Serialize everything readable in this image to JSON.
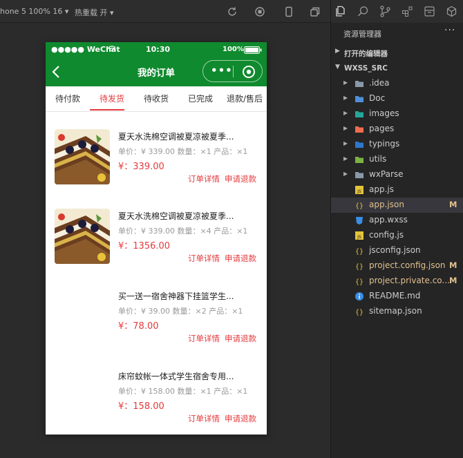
{
  "toolbar": {
    "device_label": "hone 5 100% 16",
    "hotreload_label": "热重载 开"
  },
  "explorer": {
    "title": "资源管理器",
    "more": "···",
    "open_editors": "打开的编辑器",
    "project": "WXSS_SRC",
    "folders": [
      {
        "name": ".idea",
        "icon": "folder-icon",
        "color": "#8a99a8"
      },
      {
        "name": "Doc",
        "icon": "folder-doc-icon",
        "color": "#4f8fd6"
      },
      {
        "name": "images",
        "icon": "folder-images-icon",
        "color": "#26a69a"
      },
      {
        "name": "pages",
        "icon": "folder-pages-icon",
        "color": "#ef6c50"
      },
      {
        "name": "typings",
        "icon": "folder-typescript-icon",
        "color": "#2f78c8"
      },
      {
        "name": "utils",
        "icon": "folder-utils-icon",
        "color": "#7cb342"
      },
      {
        "name": "wxParse",
        "icon": "folder-icon",
        "color": "#8a99a8"
      }
    ],
    "files": [
      {
        "name": "app.js",
        "icon": "js-file-icon",
        "badge": "",
        "modified": false,
        "selected": false
      },
      {
        "name": "app.json",
        "icon": "json-file-icon",
        "badge": "M",
        "modified": true,
        "selected": true
      },
      {
        "name": "app.wxss",
        "icon": "css-file-icon",
        "badge": "",
        "modified": false,
        "selected": false
      },
      {
        "name": "config.js",
        "icon": "js-file-icon",
        "badge": "",
        "modified": false,
        "selected": false
      },
      {
        "name": "jsconfig.json",
        "icon": "json-file-icon",
        "badge": "",
        "modified": false,
        "selected": false
      },
      {
        "name": "project.config.json",
        "icon": "json-file-icon",
        "badge": "M",
        "modified": true,
        "selected": false
      },
      {
        "name": "project.private.co...",
        "icon": "json-file-icon",
        "badge": "M",
        "modified": true,
        "selected": false
      },
      {
        "name": "README.md",
        "icon": "info-file-icon",
        "badge": "",
        "modified": false,
        "selected": false
      },
      {
        "name": "sitemap.json",
        "icon": "json-file-icon",
        "badge": "",
        "modified": false,
        "selected": false
      }
    ]
  },
  "phone": {
    "status": {
      "signal": "●●●●● WeChat",
      "time": "10:30",
      "battery": "100%"
    },
    "nav_title": "我的订单",
    "capsule_more": "•••",
    "tabs": [
      "待付款",
      "待发货",
      "待收货",
      "已完成",
      "退款/售后"
    ],
    "active_tab": 1,
    "orders": [
      {
        "title": "夏天水洗棉空调被夏凉被夏季...",
        "meta": "单价：¥ 339.00 数量：×1 产品：×1",
        "price": "¥：339.00",
        "detail": "订单详情",
        "refund": "申请退款",
        "has_image": true
      },
      {
        "title": "夏天水洗棉空调被夏凉被夏季...",
        "meta": "单价：¥ 339.00 数量：×4 产品：×1",
        "price": "¥：1356.00",
        "detail": "订单详情",
        "refund": "申请退款",
        "has_image": true
      },
      {
        "title": "买一送一宿舍神器下挂篮学生...",
        "meta": "单价：¥ 39.00 数量：×2 产品：×1",
        "price": "¥：78.00",
        "detail": "订单详情",
        "refund": "申请退款",
        "has_image": false
      },
      {
        "title": "床帘蚊帐一体式学生宿舍专用...",
        "meta": "单价：¥ 158.00 数量：×1 产品：×1",
        "price": "¥：158.00",
        "detail": "订单详情",
        "refund": "申请退款",
        "has_image": false
      }
    ]
  },
  "colors": {
    "brand_green": "#0f8a2e",
    "accent_red": "#e4393c",
    "modified": "#e2c08d"
  }
}
